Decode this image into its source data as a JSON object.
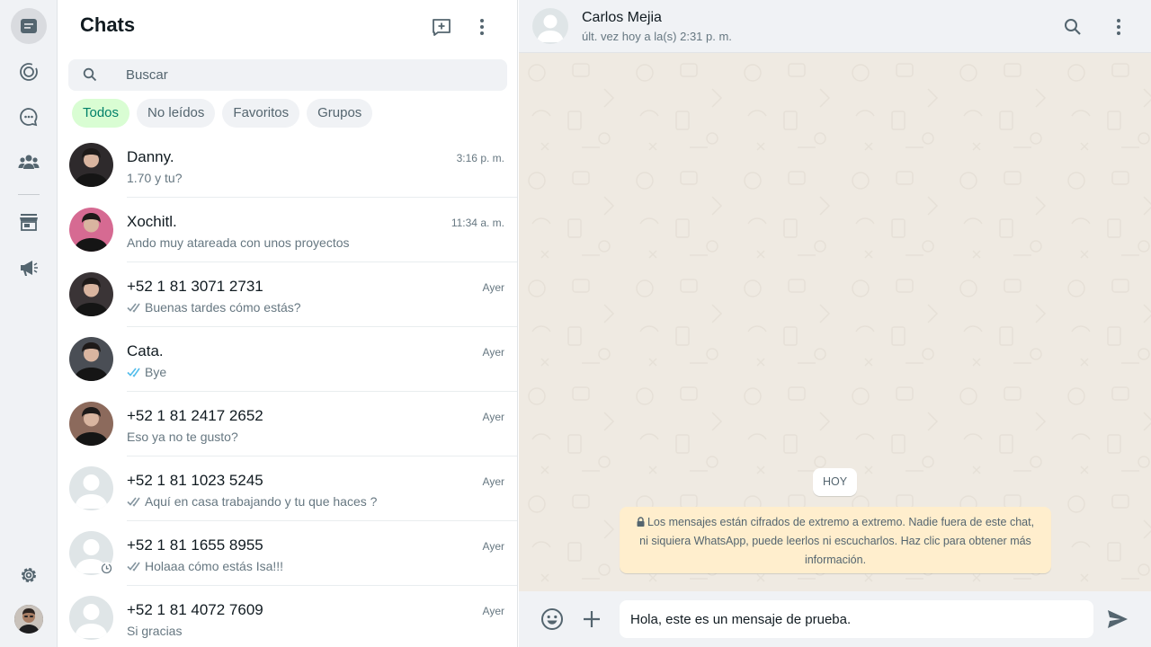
{
  "rail": {
    "items": [
      {
        "icon": "chats-icon",
        "active": true
      },
      {
        "icon": "status-icon"
      },
      {
        "icon": "channels-icon"
      },
      {
        "icon": "communities-icon"
      },
      {
        "icon": "business-tools-icon"
      },
      {
        "icon": "ads-icon"
      }
    ],
    "bottom": [
      {
        "icon": "gear-icon"
      },
      {
        "icon": "profile-avatar"
      }
    ]
  },
  "list": {
    "title": "Chats",
    "search_placeholder": "Buscar",
    "filters": [
      {
        "label": "Todos",
        "active": true
      },
      {
        "label": "No leídos"
      },
      {
        "label": "Favoritos"
      },
      {
        "label": "Grupos"
      }
    ],
    "chats": [
      {
        "name": "Danny.",
        "time": "3:16 p. m.",
        "message": "1.70 y tu?",
        "tick": "none",
        "avatar": "photo",
        "avatar_color": "#2e2a2c"
      },
      {
        "name": "Xochitl.",
        "time": "11:34 a. m.",
        "message": "Ando muy atareada con unos proyectos",
        "tick": "none",
        "avatar": "photo",
        "avatar_color": "#d66a92"
      },
      {
        "name": "+52 1 81 3071 2731",
        "time": "Ayer",
        "message": "Buenas tardes cómo estás?",
        "tick": "grey",
        "avatar": "photo",
        "avatar_color": "#3a3436"
      },
      {
        "name": "Cata.",
        "time": "Ayer",
        "message": "Bye",
        "tick": "blue",
        "avatar": "photo",
        "avatar_color": "#4a4e55"
      },
      {
        "name": "+52 1 81 2417 2652",
        "time": "Ayer",
        "message": "Eso ya no te gusto?",
        "tick": "none",
        "avatar": "photo",
        "avatar_color": "#8c6a5c"
      },
      {
        "name": "+52 1 81 1023 5245",
        "time": "Ayer",
        "message": "Aquí en casa trabajando y tu que haces ?",
        "tick": "grey",
        "avatar": "default"
      },
      {
        "name": "+52 1 81 1655 8955",
        "time": "Ayer",
        "message": "Holaaa cómo estás Isa!!!",
        "tick": "grey",
        "avatar": "default-timer"
      },
      {
        "name": "+52 1 81 4072 7609",
        "time": "Ayer",
        "message": "Si gracias",
        "tick": "none",
        "avatar": "default"
      }
    ]
  },
  "conversation": {
    "name": "Carlos Mejia",
    "status": "últ. vez hoy a la(s) 2:31 p. m.",
    "date_label": "HOY",
    "encryption_notice": "Los mensajes están cifrados de extremo a extremo. Nadie fuera de este chat, ni siquiera WhatsApp, puede leerlos ni escucharlos. Haz clic para obtener más información.",
    "composer_value": "Hola, este es un mensaje de prueba."
  },
  "colors": {
    "accent": "#008069",
    "chip_active_bg": "#d9fdd3",
    "read_tick": "#53bdeb",
    "wallpaper": "#efeae2",
    "notice_bg": "#ffeecd"
  }
}
